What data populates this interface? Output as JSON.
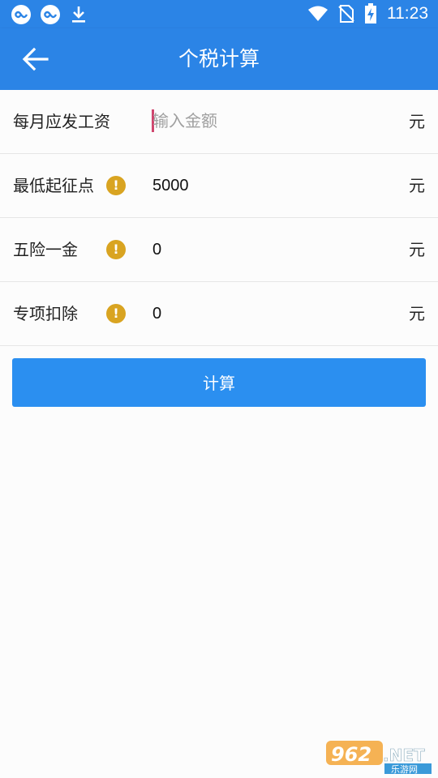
{
  "status_bar": {
    "time": "11:23",
    "left_icons": [
      "app-icon",
      "app-icon",
      "download-icon"
    ],
    "right_icons": [
      "wifi-icon",
      "no-sim-icon",
      "battery-charging-icon"
    ]
  },
  "header": {
    "title": "个税计算",
    "back_icon": "arrow-left-icon"
  },
  "form": {
    "rows": [
      {
        "label": "每月应发工资",
        "value": "",
        "placeholder": "输入金额",
        "unit": "元",
        "has_info": false
      },
      {
        "label": "最低起征点",
        "value": "5000",
        "placeholder": "",
        "unit": "元",
        "has_info": true
      },
      {
        "label": "五险一金",
        "value": "0",
        "placeholder": "",
        "unit": "元",
        "has_info": true
      },
      {
        "label": "专项扣除",
        "value": "0",
        "placeholder": "",
        "unit": "元",
        "has_info": true
      }
    ],
    "info_glyph": "!"
  },
  "actions": {
    "calculate_label": "计算"
  },
  "watermark": {
    "text": "962.NET",
    "subtext": "乐游网"
  },
  "colors": {
    "primary": "#2b84e6",
    "button": "#2b8ff0",
    "info": "#d9a421",
    "cursor": "#d0466e"
  }
}
